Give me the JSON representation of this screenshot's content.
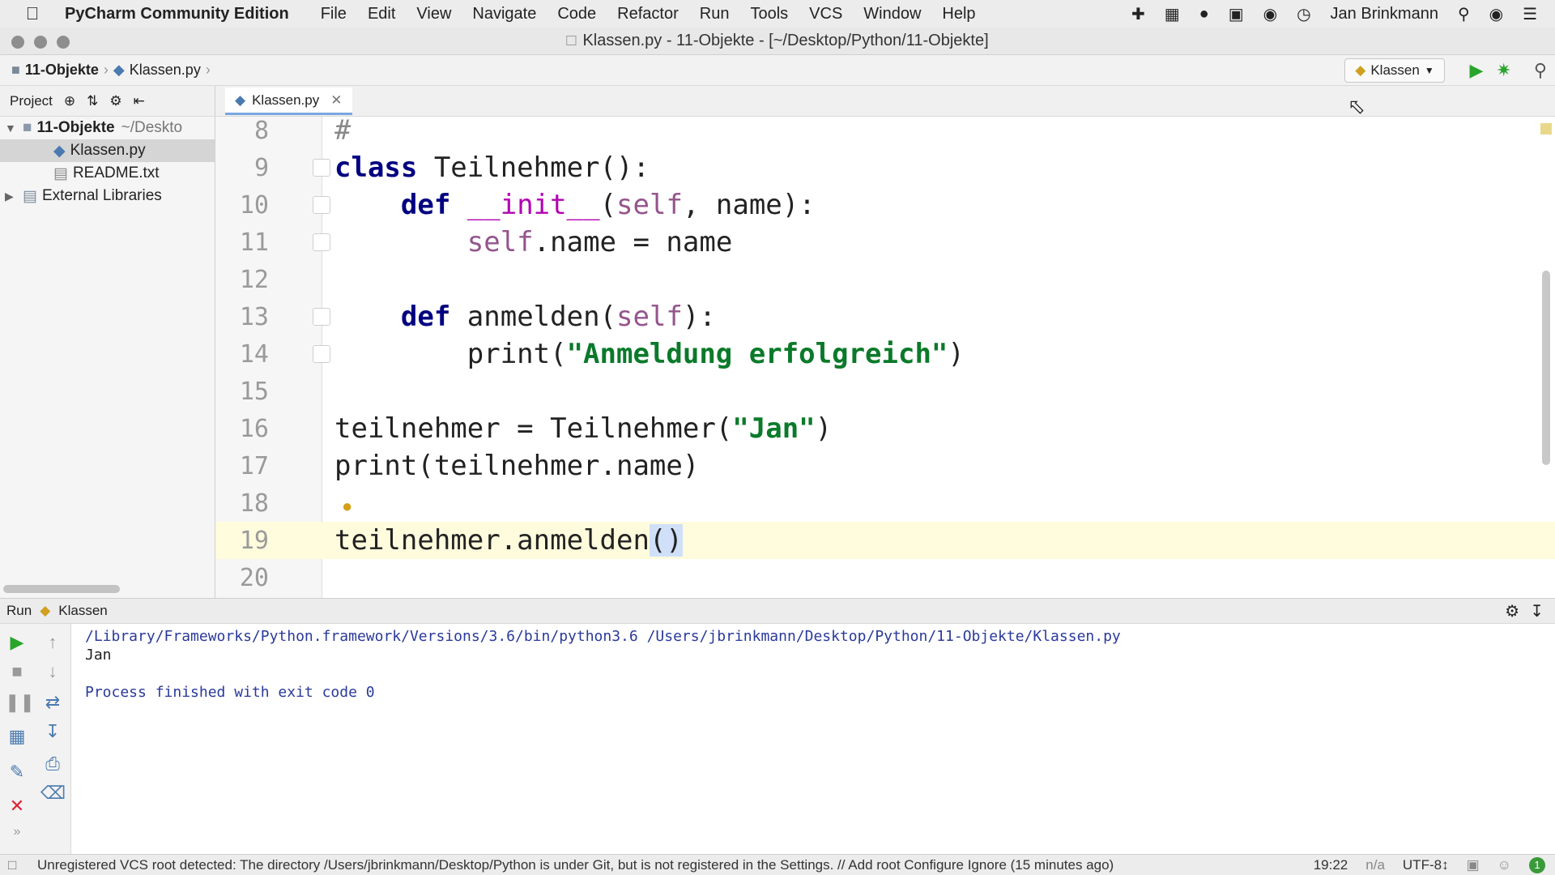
{
  "menubar": {
    "app_name": "PyCharm Community Edition",
    "items": [
      "File",
      "Edit",
      "View",
      "Navigate",
      "Code",
      "Refactor",
      "Run",
      "Tools",
      "VCS",
      "Window",
      "Help"
    ],
    "user": "Jan Brinkmann"
  },
  "window": {
    "title": "Klassen.py - 11-Objekte - [~/Desktop/Python/11-Objekte]"
  },
  "navbar": {
    "project": "11-Objekte",
    "file": "Klassen.py",
    "run_config": "Klassen"
  },
  "project_panel": {
    "label": "Project",
    "root": "11-Objekte",
    "root_path": "~/Deskto",
    "files": [
      "Klassen.py",
      "README.txt"
    ],
    "external": "External Libraries"
  },
  "editor": {
    "tab": "Klassen.py",
    "line_numbers": [
      "8",
      "9",
      "10",
      "11",
      "12",
      "13",
      "14",
      "15",
      "16",
      "17",
      "18",
      "19",
      "20"
    ],
    "current_line": "19"
  },
  "run_panel": {
    "label": "Run",
    "config": "Klassen",
    "output": [
      "/Library/Frameworks/Python.framework/Versions/3.6/bin/python3.6 /Users/jbrinkmann/Desktop/Python/11-Objekte/Klassen.py",
      "Jan",
      "",
      "Process finished with exit code 0"
    ]
  },
  "statusbar": {
    "message": "Unregistered VCS root detected: The directory /Users/jbrinkmann/Desktop/Python is under Git, but is not registered in the Settings. // Add root  Configure  Ignore (15 minutes ago)",
    "position": "19:22",
    "na": "n/a",
    "encoding": "UTF-8↕"
  }
}
